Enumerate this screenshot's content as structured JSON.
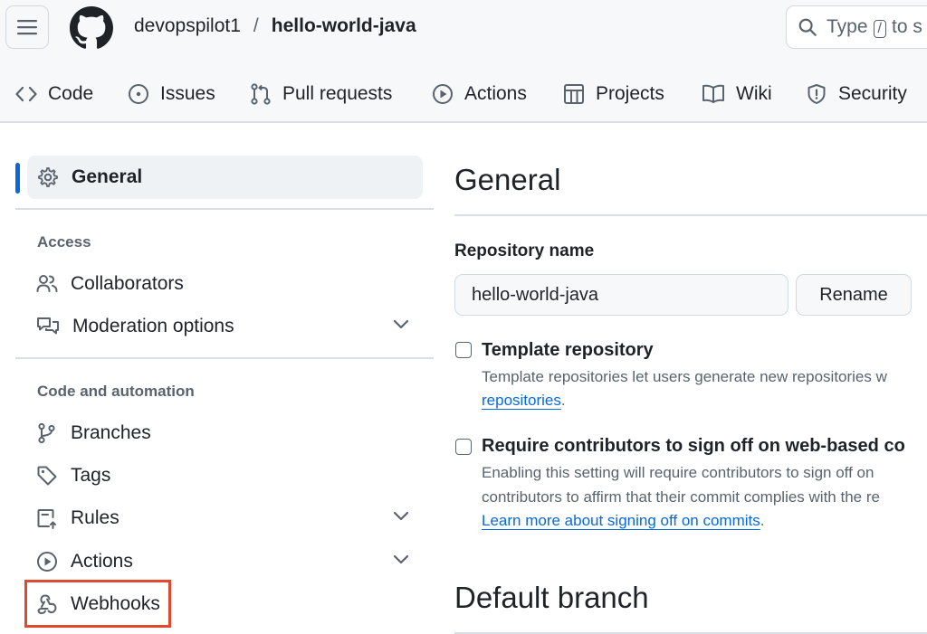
{
  "header": {
    "owner": "devopspilot1",
    "separator": "/",
    "repo": "hello-world-java",
    "search": {
      "prefix": "Type",
      "key": "/",
      "suffix": "to s"
    }
  },
  "nav": [
    {
      "label": "Code",
      "icon": "code-icon"
    },
    {
      "label": "Issues",
      "icon": "issue-icon"
    },
    {
      "label": "Pull requests",
      "icon": "pull-request-icon"
    },
    {
      "label": "Actions",
      "icon": "play-icon"
    },
    {
      "label": "Projects",
      "icon": "table-icon"
    },
    {
      "label": "Wiki",
      "icon": "book-icon"
    },
    {
      "label": "Security",
      "icon": "shield-icon"
    }
  ],
  "sidebar": {
    "general": "General",
    "access_heading": "Access",
    "collaborators": "Collaborators",
    "moderation": "Moderation options",
    "code_heading": "Code and automation",
    "branches": "Branches",
    "tags": "Tags",
    "rules": "Rules",
    "actions": "Actions",
    "webhooks": "Webhooks"
  },
  "main": {
    "title": "General",
    "repo_name_label": "Repository name",
    "repo_name_value": "hello-world-java",
    "rename_label": "Rename",
    "template": {
      "title": "Template repository",
      "desc": "Template repositories let users generate new repositories w",
      "link": "repositories",
      "link_suffix": "."
    },
    "signoff": {
      "title": "Require contributors to sign off on web-based co",
      "desc1": "Enabling this setting will require contributors to sign off on",
      "desc2": "contributors to affirm that their commit complies with the re",
      "link": "Learn more about signing off on commits",
      "link_suffix": "."
    },
    "default_branch_title": "Default branch"
  },
  "colors": {
    "accent": "#0969da",
    "highlight": "#e0482f"
  }
}
